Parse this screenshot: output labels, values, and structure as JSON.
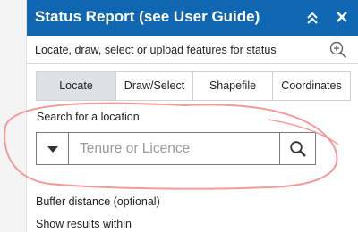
{
  "header": {
    "title": "Status Report (see User Guide)",
    "collapse_icon": "double-chevron-up-icon",
    "close_icon": "close-icon"
  },
  "subheader": {
    "text": "Locate, draw, select or upload features for status",
    "zoom_icon": "zoom-in-icon"
  },
  "tabs": [
    {
      "label": "Locate",
      "active": true
    },
    {
      "label": "Draw/Select",
      "active": false
    },
    {
      "label": "Shapefile",
      "active": false
    },
    {
      "label": "Coordinates",
      "active": false
    }
  ],
  "search": {
    "label": "Search for a location",
    "placeholder": "Tenure or Licence",
    "value": "",
    "dropdown_icon": "caret-down-icon",
    "search_icon": "search-icon"
  },
  "options": {
    "buffer_label": "Buffer distance (optional)",
    "results_label": "Show results within"
  },
  "colors": {
    "header_bg": "#0f67b1",
    "active_tab_bg": "#dde2e6",
    "annotation_stroke": "#f08a8a"
  }
}
